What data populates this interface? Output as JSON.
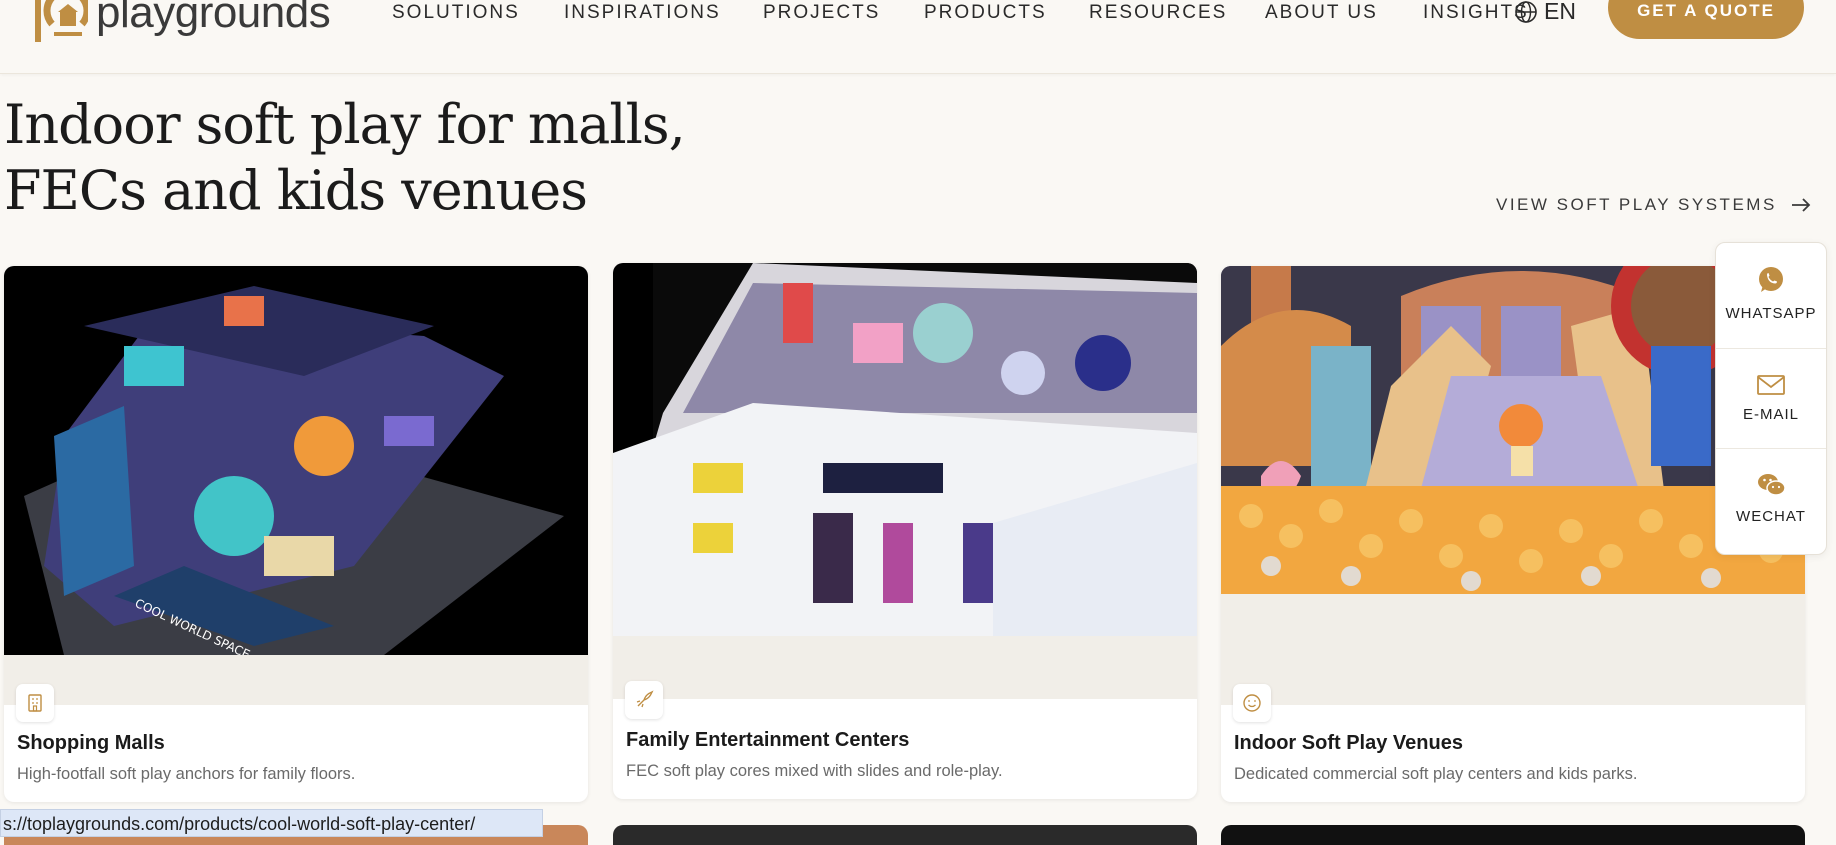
{
  "header": {
    "logo_text": "playgrounds",
    "nav": [
      "SOLUTIONS",
      "INSPIRATIONS",
      "PROJECTS",
      "PRODUCTS",
      "RESOURCES",
      "ABOUT US",
      "INSIGHTS"
    ],
    "lang": "EN",
    "quote_label": "GET A QUOTE"
  },
  "hero": {
    "title_line1": "Indoor soft play for malls,",
    "title_line2": "FECs and kids venues",
    "view_link": "VIEW SOFT PLAY SYSTEMS"
  },
  "cards": [
    {
      "title": "Shopping Malls",
      "desc": "High-footfall soft play anchors for family floors.",
      "icon": "building-icon"
    },
    {
      "title": "Family Entertainment Centers",
      "desc": "FEC soft play cores mixed with slides and role-play.",
      "icon": "rocket-icon"
    },
    {
      "title": "Indoor Soft Play Venues",
      "desc": "Dedicated commercial soft play centers and kids parks.",
      "icon": "smiley-icon"
    }
  ],
  "contact": [
    {
      "label": "WHATSAPP",
      "icon": "whatsapp-icon"
    },
    {
      "label": "E-MAIL",
      "icon": "mail-icon"
    },
    {
      "label": "WECHAT",
      "icon": "wechat-icon"
    }
  ],
  "status_url": "s://toplaygrounds.com/products/cool-world-soft-play-center/",
  "colors": {
    "accent": "#bf8e43",
    "background": "#faf8f4",
    "band": "#f1eee8"
  }
}
